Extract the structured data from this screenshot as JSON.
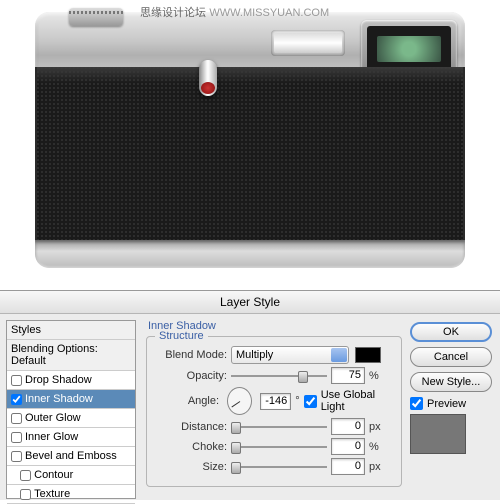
{
  "watermark": {
    "cn": "思缘设计论坛",
    "url": "WWW.MISSYUAN.COM"
  },
  "dialog": {
    "title": "Layer Style",
    "styles_header": "Styles",
    "blending": "Blending Options: Default",
    "items": [
      {
        "label": "Drop Shadow",
        "checked": false
      },
      {
        "label": "Inner Shadow",
        "checked": true,
        "selected": true
      },
      {
        "label": "Outer Glow",
        "checked": false
      },
      {
        "label": "Inner Glow",
        "checked": false
      },
      {
        "label": "Bevel and Emboss",
        "checked": false
      },
      {
        "label": "Contour",
        "checked": false
      },
      {
        "label": "Texture",
        "checked": false
      }
    ],
    "panel_title": "Inner Shadow",
    "group_title": "Structure",
    "blend_mode": {
      "label": "Blend Mode:",
      "value": "Multiply"
    },
    "opacity": {
      "label": "Opacity:",
      "value": "75",
      "unit": "%"
    },
    "angle": {
      "label": "Angle:",
      "value": "-146",
      "unit": "°",
      "global_label": "Use Global Light",
      "global_checked": true
    },
    "distance": {
      "label": "Distance:",
      "value": "0",
      "unit": "px"
    },
    "choke": {
      "label": "Choke:",
      "value": "0",
      "unit": "%"
    },
    "size": {
      "label": "Size:",
      "value": "0",
      "unit": "px"
    },
    "buttons": {
      "ok": "OK",
      "cancel": "Cancel",
      "new_style": "New Style...",
      "preview": "Preview"
    }
  }
}
